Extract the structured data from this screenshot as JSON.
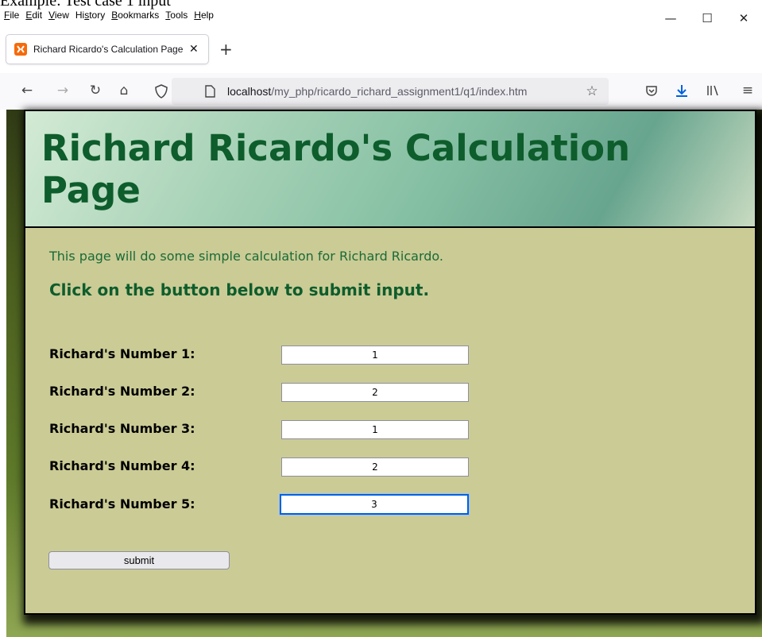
{
  "document": {
    "caption": "Example: Test case 1 input"
  },
  "browser": {
    "menu": [
      {
        "label": "File",
        "key": "F",
        "rest": "ile"
      },
      {
        "label": "Edit",
        "key": "E",
        "rest": "dit"
      },
      {
        "label": "View",
        "key": "V",
        "rest": "iew"
      },
      {
        "label": "History",
        "pre": "Hi",
        "key": "s",
        "rest": "tory"
      },
      {
        "label": "Bookmarks",
        "key": "B",
        "rest": "ookmarks"
      },
      {
        "label": "Tools",
        "key": "T",
        "rest": "ools"
      },
      {
        "label": "Help",
        "key": "H",
        "rest": "elp"
      }
    ],
    "window_controls": {
      "minimize": "—",
      "maximize": "☐",
      "close": "✕"
    },
    "tab": {
      "title": "Richard Ricardo's Calculation Page",
      "close": "✕",
      "favicon": "xampp-favicon-icon"
    },
    "new_tab": "+",
    "nav": {
      "back": "←",
      "forward": "→",
      "reload": "↻",
      "home": "⌂",
      "shield": "shield-icon",
      "page": "page-icon",
      "star": "☆",
      "pocket": "pocket-icon",
      "download": "download-icon",
      "library": "library-icon",
      "menu": "≡"
    },
    "url": {
      "host": "localhost",
      "path": "/my_php/ricardo_richard_assignment1/q1/index.htm"
    },
    "colors": {
      "download_accent": "#0060df",
      "favicon": "#f66a0a"
    }
  },
  "page": {
    "title": "Richard Ricardo's Calculation Page",
    "intro": "This page will do some simple calculation for Richard Ricardo.",
    "instruction": "Click on the button below to submit input.",
    "fields": [
      {
        "label": "Richard's Number 1:",
        "value": "1"
      },
      {
        "label": "Richard's Number 2:",
        "value": "2"
      },
      {
        "label": "Richard's Number 3:",
        "value": "1"
      },
      {
        "label": "Richard's Number 4:",
        "value": "2"
      },
      {
        "label": "Richard's Number 5:",
        "value": "3"
      }
    ],
    "submit_label": "submit",
    "colors": {
      "heading": "#0e5d2c",
      "card_background": "#cbcb96"
    }
  }
}
